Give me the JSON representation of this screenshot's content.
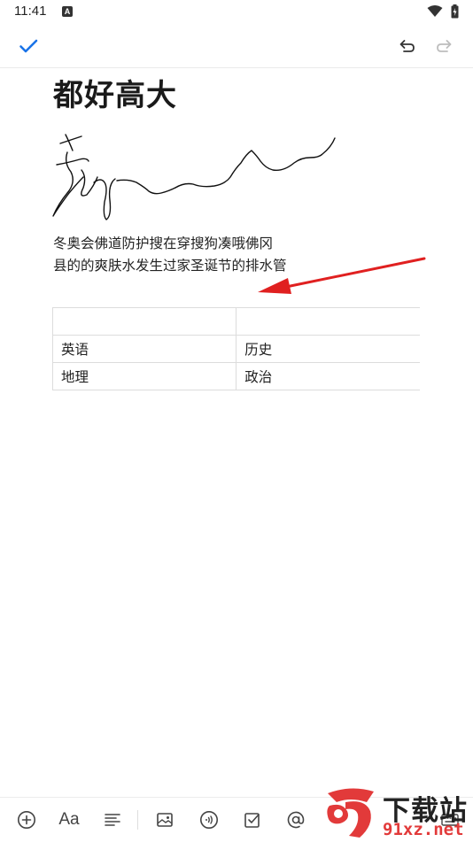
{
  "status_bar": {
    "time": "11:41",
    "notification_icon": "A"
  },
  "note": {
    "title": "都好高大",
    "body_lines": [
      "冬奥会佛道防护搜在穿搜狗凑哦佛冈",
      "县的的爽肤水发生过家圣诞节的排水管"
    ],
    "table": {
      "rows": [
        [
          "",
          ""
        ],
        [
          "英语",
          "历史"
        ],
        [
          "地理",
          "政治"
        ]
      ]
    }
  },
  "toolbar": {
    "text_format_label": "Aa"
  },
  "watermark": {
    "logo_text": "9",
    "cn_text": "下载站",
    "url_text": "91xz.net"
  },
  "colors": {
    "accent": "#1a73e8",
    "annotation": "#e02020",
    "watermark_red": "#e23a3a"
  }
}
